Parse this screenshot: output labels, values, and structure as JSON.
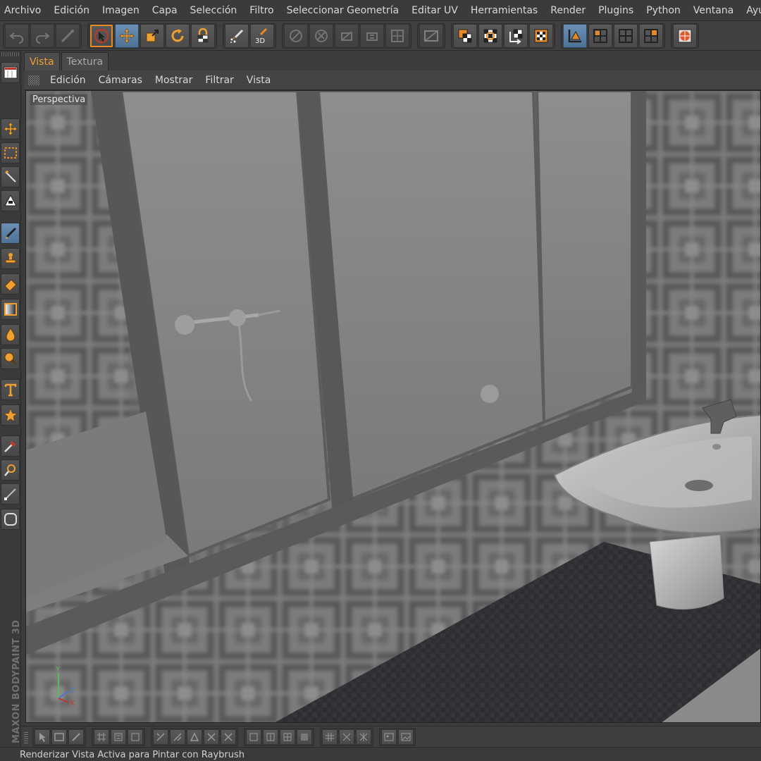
{
  "menubar": {
    "items": [
      "Archivo",
      "Edición",
      "Imagen",
      "Capa",
      "Selección",
      "Filtro",
      "Seleccionar Geometría",
      "Editar UV",
      "Herramientas",
      "Render",
      "Plugins",
      "Python",
      "Ventana",
      "Ayuda"
    ]
  },
  "toolbar": {
    "groups": [
      [
        "undo-icon",
        "redo-icon",
        "brush-edit-icon"
      ],
      [
        "select-arrow-icon",
        "move-icon",
        "scale-icon",
        "rotate-icon",
        "lock-texture-icon"
      ],
      [
        "paint-spray-icon",
        "paint-3d-icon"
      ],
      [
        "uv-points-icon",
        "uv-edges-icon",
        "uv-polygons-icon",
        "uv-options-icon",
        "uv-grid-icon"
      ],
      [
        "texture-view-icon"
      ],
      [
        "layer-show-icon",
        "layer-alpha-icon",
        "layer-projection-icon",
        "checker-icon"
      ],
      [
        "axis-mode-icon",
        "view-single-icon",
        "view-quad-icon",
        "view-grid-icon"
      ],
      [
        "render-sphere-icon"
      ]
    ],
    "labels": {
      "paint_3d": "3D"
    }
  },
  "leftbar": {
    "tools": [
      "layout-icon",
      "move-tool-icon",
      "rect-select-icon",
      "magic-wand-icon",
      "polygon-select-icon",
      "brush-tool-icon",
      "clone-stamp-icon",
      "eraser-icon",
      "gradient-icon",
      "drop-icon",
      "magnify-icon",
      "text-tool-icon",
      "star-shape-icon",
      "eyedropper-icon",
      "zoom-view-icon",
      "line-tool-icon",
      "circle-tool-icon"
    ]
  },
  "tabs": [
    {
      "label": "Vista",
      "active": true
    },
    {
      "label": "Textura",
      "active": false
    }
  ],
  "viewmenu": {
    "items": [
      "Edición",
      "Cámaras",
      "Mostrar",
      "Filtrar",
      "Vista"
    ]
  },
  "viewport": {
    "label": "Perspectiva",
    "axis": {
      "y": "Y",
      "z": "Z",
      "x": "X"
    }
  },
  "brand": "MAXON BODYPAINT 3D",
  "status": "Renderizar Vista Activa para Pintar con Raybrush",
  "colors": {
    "accent": "#e58a25",
    "active_blue": "#5b82a8"
  }
}
